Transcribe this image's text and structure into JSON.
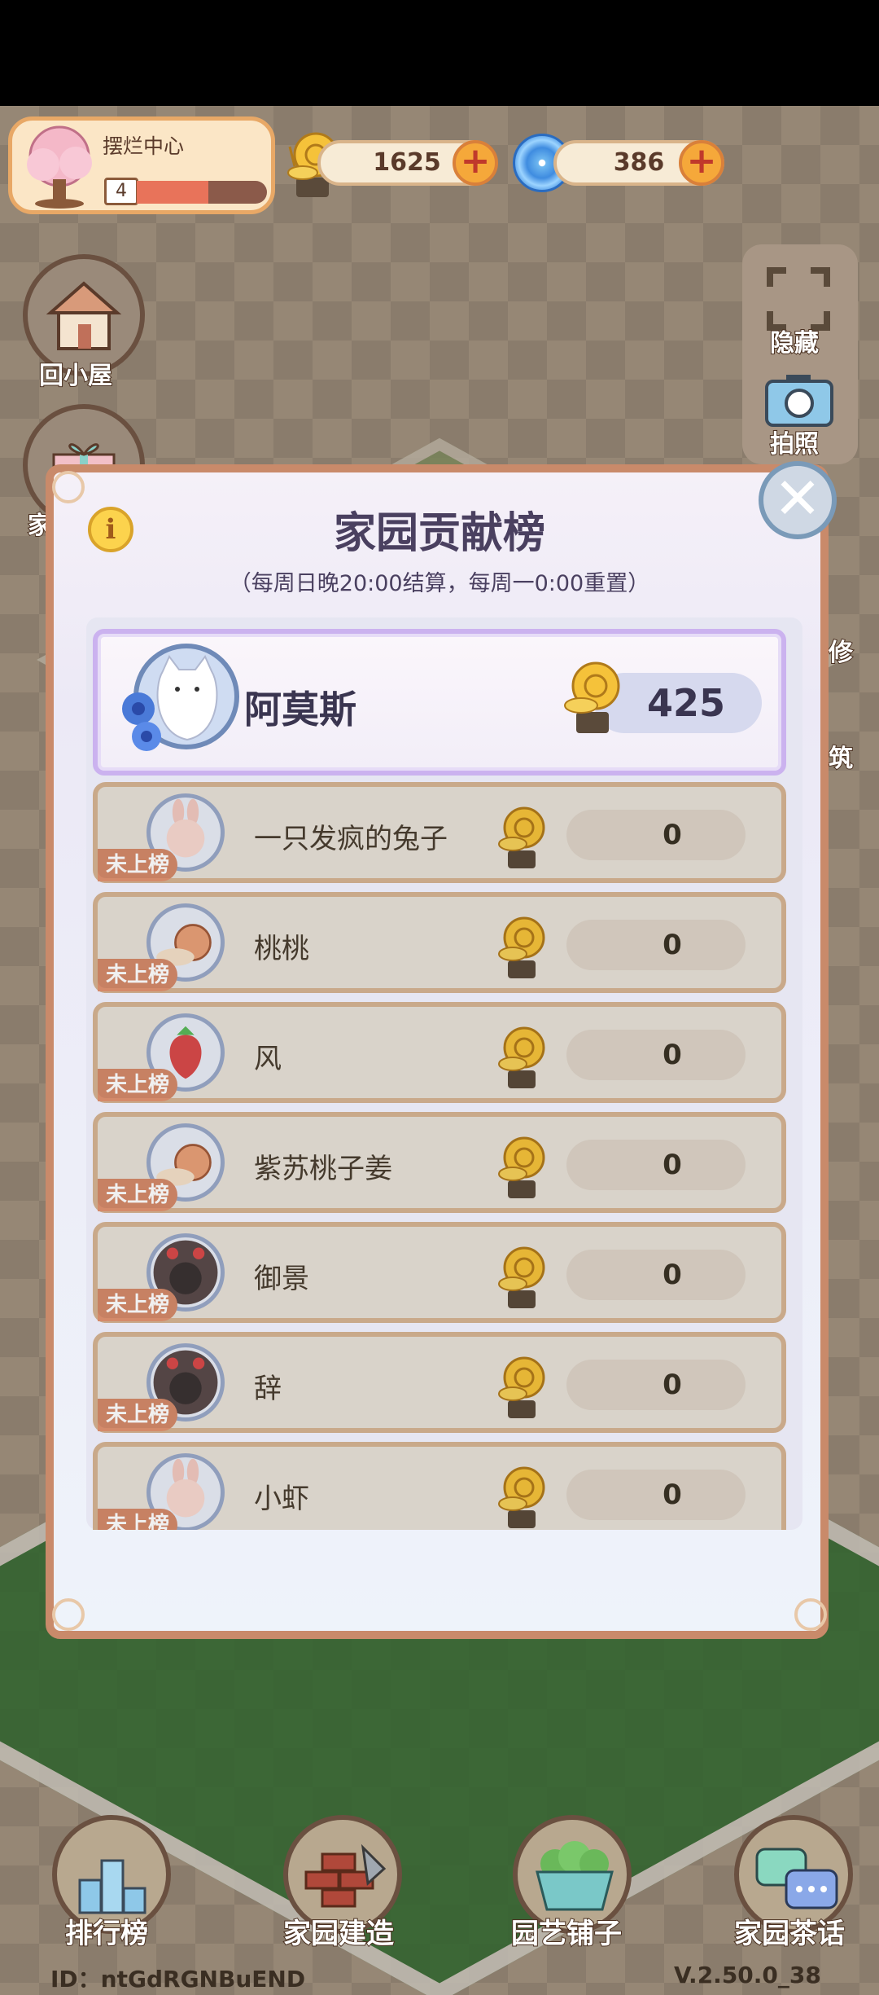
{
  "hud": {
    "garden_name": "摆烂中心",
    "level": "4",
    "level_progress": 0.55,
    "snail_currency": "1625",
    "swirl_currency": "386",
    "plus_symbol": "+"
  },
  "side_left": {
    "home_label": "回小屋",
    "partial_label": "家"
  },
  "side_right": {
    "hide_label": "隐藏",
    "photo_label": "拍照",
    "partial_1": "修",
    "partial_2": "筑"
  },
  "dialog": {
    "title": "家园贡献榜",
    "subtitle": "（每周日晚20:00结算，每周一0:00重置）",
    "info_symbol": "i",
    "close_symbol": "✕",
    "top_entry": {
      "name": "阿莫斯",
      "score": "425"
    },
    "rows": [
      {
        "name": "一只发疯的兔子",
        "score": "0",
        "tag": "未上榜",
        "avatar": "bunny-avatar"
      },
      {
        "name": "桃桃",
        "score": "0",
        "tag": "未上榜",
        "avatar": "snail-avatar"
      },
      {
        "name": "风",
        "score": "0",
        "tag": "未上榜",
        "avatar": "strawberry-avatar"
      },
      {
        "name": "紫苏桃子姜",
        "score": "0",
        "tag": "未上榜",
        "avatar": "snail-avatar"
      },
      {
        "name": "御景",
        "score": "0",
        "tag": "未上榜",
        "avatar": "cake-avatar"
      },
      {
        "name": "辞",
        "score": "0",
        "tag": "未上榜",
        "avatar": "cake-avatar"
      },
      {
        "name": "小虾",
        "score": "0",
        "tag": "未上榜",
        "avatar": "bunny-avatar"
      }
    ]
  },
  "bottom_nav": {
    "rank_label": "排行榜",
    "build_label": "家园建造",
    "shop_label": "园艺铺子",
    "chat_label": "家园茶话"
  },
  "footer": {
    "id_text": "ID：ntGdRGNBuEND",
    "version_text": "V.2.50.0_38"
  },
  "colors": {
    "dialog_border": "#c98a6a",
    "top_entry_border": "#cbb2ef",
    "row_tag": "#d48a6a",
    "plus_button": "#f5a83a"
  }
}
